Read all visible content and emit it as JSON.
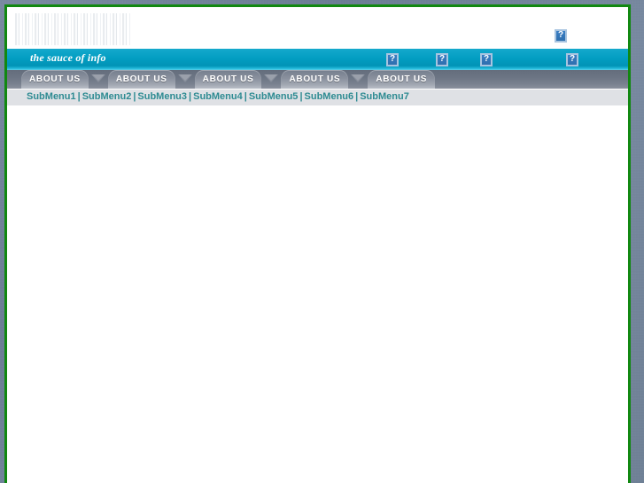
{
  "page": {
    "background_color": "#6b7f99",
    "frame_border_color": "#118811",
    "content_background": "#ffffff"
  },
  "header": {
    "logo_placeholder_name": "logo-texture-image",
    "right_icon": {
      "name": "broken-image-icon",
      "glyph": "?"
    }
  },
  "tagline_bar": {
    "tagline": "the sauce of info",
    "background_color": "#0099bb",
    "icons": [
      {
        "name": "broken-image-icon",
        "glyph": "?"
      },
      {
        "name": "broken-image-icon",
        "glyph": "?"
      },
      {
        "name": "broken-image-icon",
        "glyph": "?"
      },
      {
        "name": "broken-image-icon",
        "glyph": "?"
      }
    ]
  },
  "nav": {
    "background_color": "#6c7584",
    "tabs": [
      {
        "label": "ABOUT US"
      },
      {
        "label": "ABOUT US"
      },
      {
        "label": "ABOUT US"
      },
      {
        "label": "ABOUT US"
      },
      {
        "label": "ABOUT US"
      }
    ]
  },
  "submenu": {
    "background_color": "#dfe1e5",
    "text_color": "#2e8b92",
    "separator": "|",
    "items": [
      {
        "label": "SubMenu1"
      },
      {
        "label": "SubMenu2"
      },
      {
        "label": "SubMenu3"
      },
      {
        "label": "SubMenu4"
      },
      {
        "label": "SubMenu5"
      },
      {
        "label": "SubMenu6"
      },
      {
        "label": "SubMenu7"
      }
    ]
  },
  "main": {
    "body_text": ""
  }
}
